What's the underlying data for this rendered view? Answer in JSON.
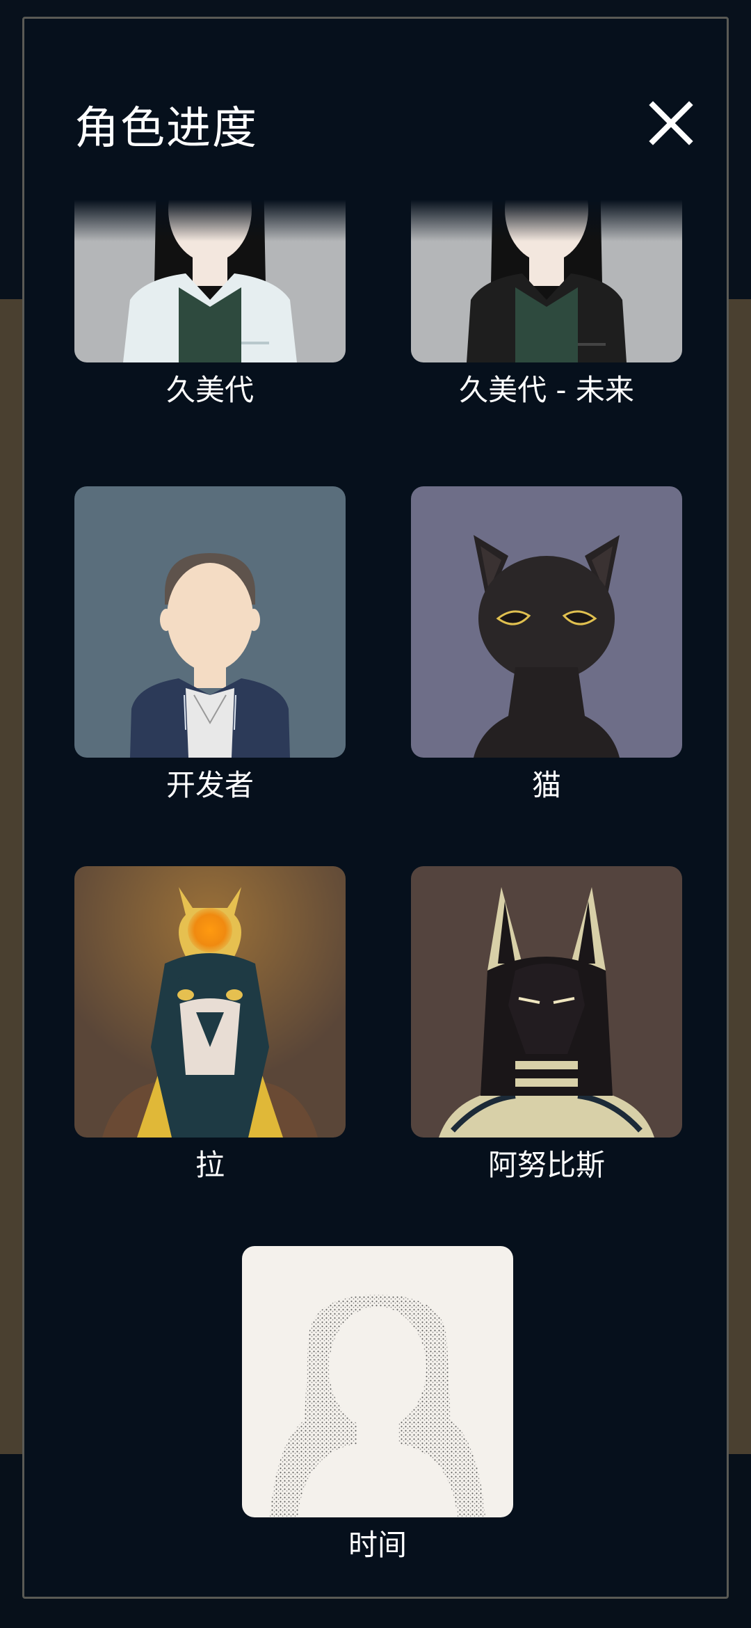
{
  "header": {
    "title": "角色进度",
    "close_icon": "close-icon"
  },
  "characters": [
    {
      "name": "久美代",
      "portrait_bg": "#b4b6b8"
    },
    {
      "name": "久美代 - 未来",
      "portrait_bg": "#b4b6b8"
    },
    {
      "name": "开发者",
      "portrait_bg": "#5a6e7c"
    },
    {
      "name": "猫",
      "portrait_bg": "#6e6e88"
    },
    {
      "name": "拉",
      "portrait_bg": "#5a4638"
    },
    {
      "name": "阿努比斯",
      "portrait_bg": "#54443e"
    },
    {
      "name": "时间",
      "portrait_bg": "#f4f1ec"
    }
  ],
  "colors": {
    "modal_bg": "#06101c",
    "text": "#ffffff",
    "accent_sun": "#f08a10"
  }
}
